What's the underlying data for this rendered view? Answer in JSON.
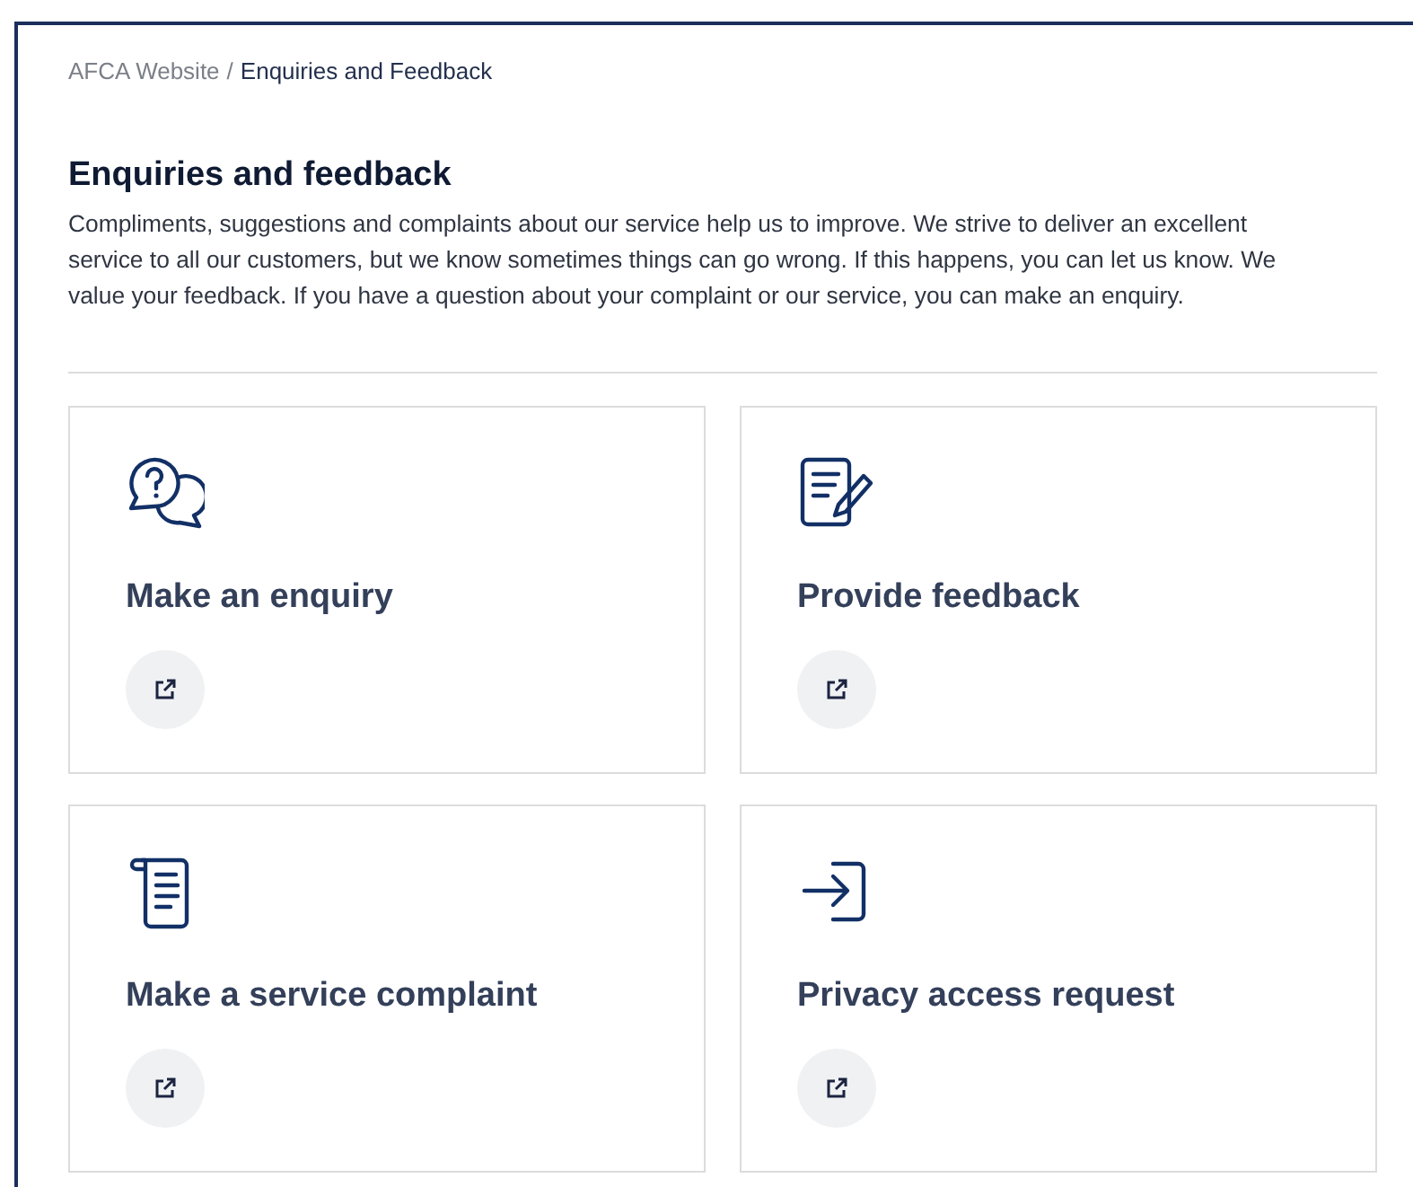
{
  "breadcrumb": [
    {
      "label": "AFCA Website",
      "current": false
    },
    {
      "label": "Enquiries and Feedback",
      "current": true
    }
  ],
  "breadcrumb_separator": "/",
  "heading": "Enquiries and feedback",
  "intro": "Compliments, suggestions and complaints about our service help us to improve. We strive to deliver an excellent service to all our customers, but we know sometimes things can go wrong. If this happens, you can let us know. We value your feedback. If you have a question about your complaint or our service, you can make an enquiry.",
  "cards": [
    {
      "title": "Make an enquiry",
      "kind": "question-chat"
    },
    {
      "title": "Provide feedback",
      "kind": "document-pen"
    },
    {
      "title": "Make a service complaint",
      "kind": "scroll"
    },
    {
      "title": "Privacy access request",
      "kind": "sign-in"
    }
  ]
}
